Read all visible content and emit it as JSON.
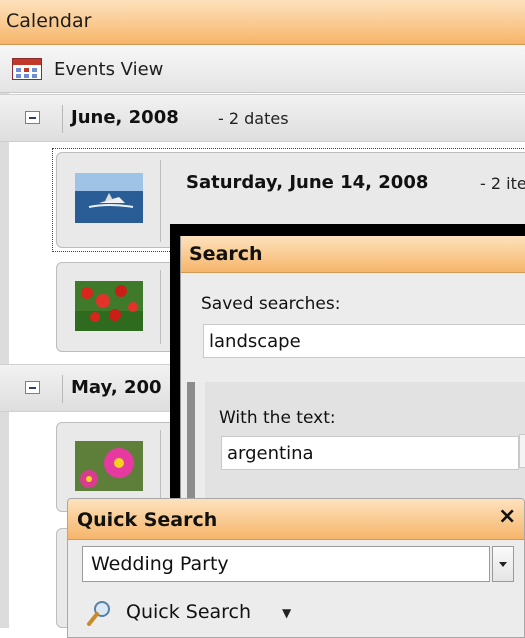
{
  "calendar": {
    "title": "Calendar"
  },
  "toolbar": {
    "events_view_label": "Events View"
  },
  "groups": [
    {
      "title": "June, 2008",
      "count": "- 2 dates",
      "events": [
        {
          "title": "Saturday, June 14, 2008",
          "count": "- 2 ite",
          "thumbnail": "boat-photo"
        },
        {
          "title": "",
          "count": "",
          "thumbnail": "poppies-photo"
        }
      ]
    },
    {
      "title": "May, 200",
      "count": "",
      "events": [
        {
          "title": "",
          "count": "",
          "thumbnail": "pink-flower-photo"
        }
      ]
    }
  ],
  "search": {
    "title": "Search",
    "saved_searches_label": "Saved searches:",
    "saved_searches_value": "landscape",
    "with_text_label": "With the text:",
    "with_text_value": "argentina"
  },
  "quick_search": {
    "title": "Quick Search",
    "close_icon": "×",
    "input_value": "Wedding Party",
    "button_label": "Quick Search",
    "button_icon": "magnifier-icon",
    "button_arrow": "▼"
  },
  "colors": {
    "header_orange": "#f6b56a",
    "header_light": "#fde2bd"
  }
}
